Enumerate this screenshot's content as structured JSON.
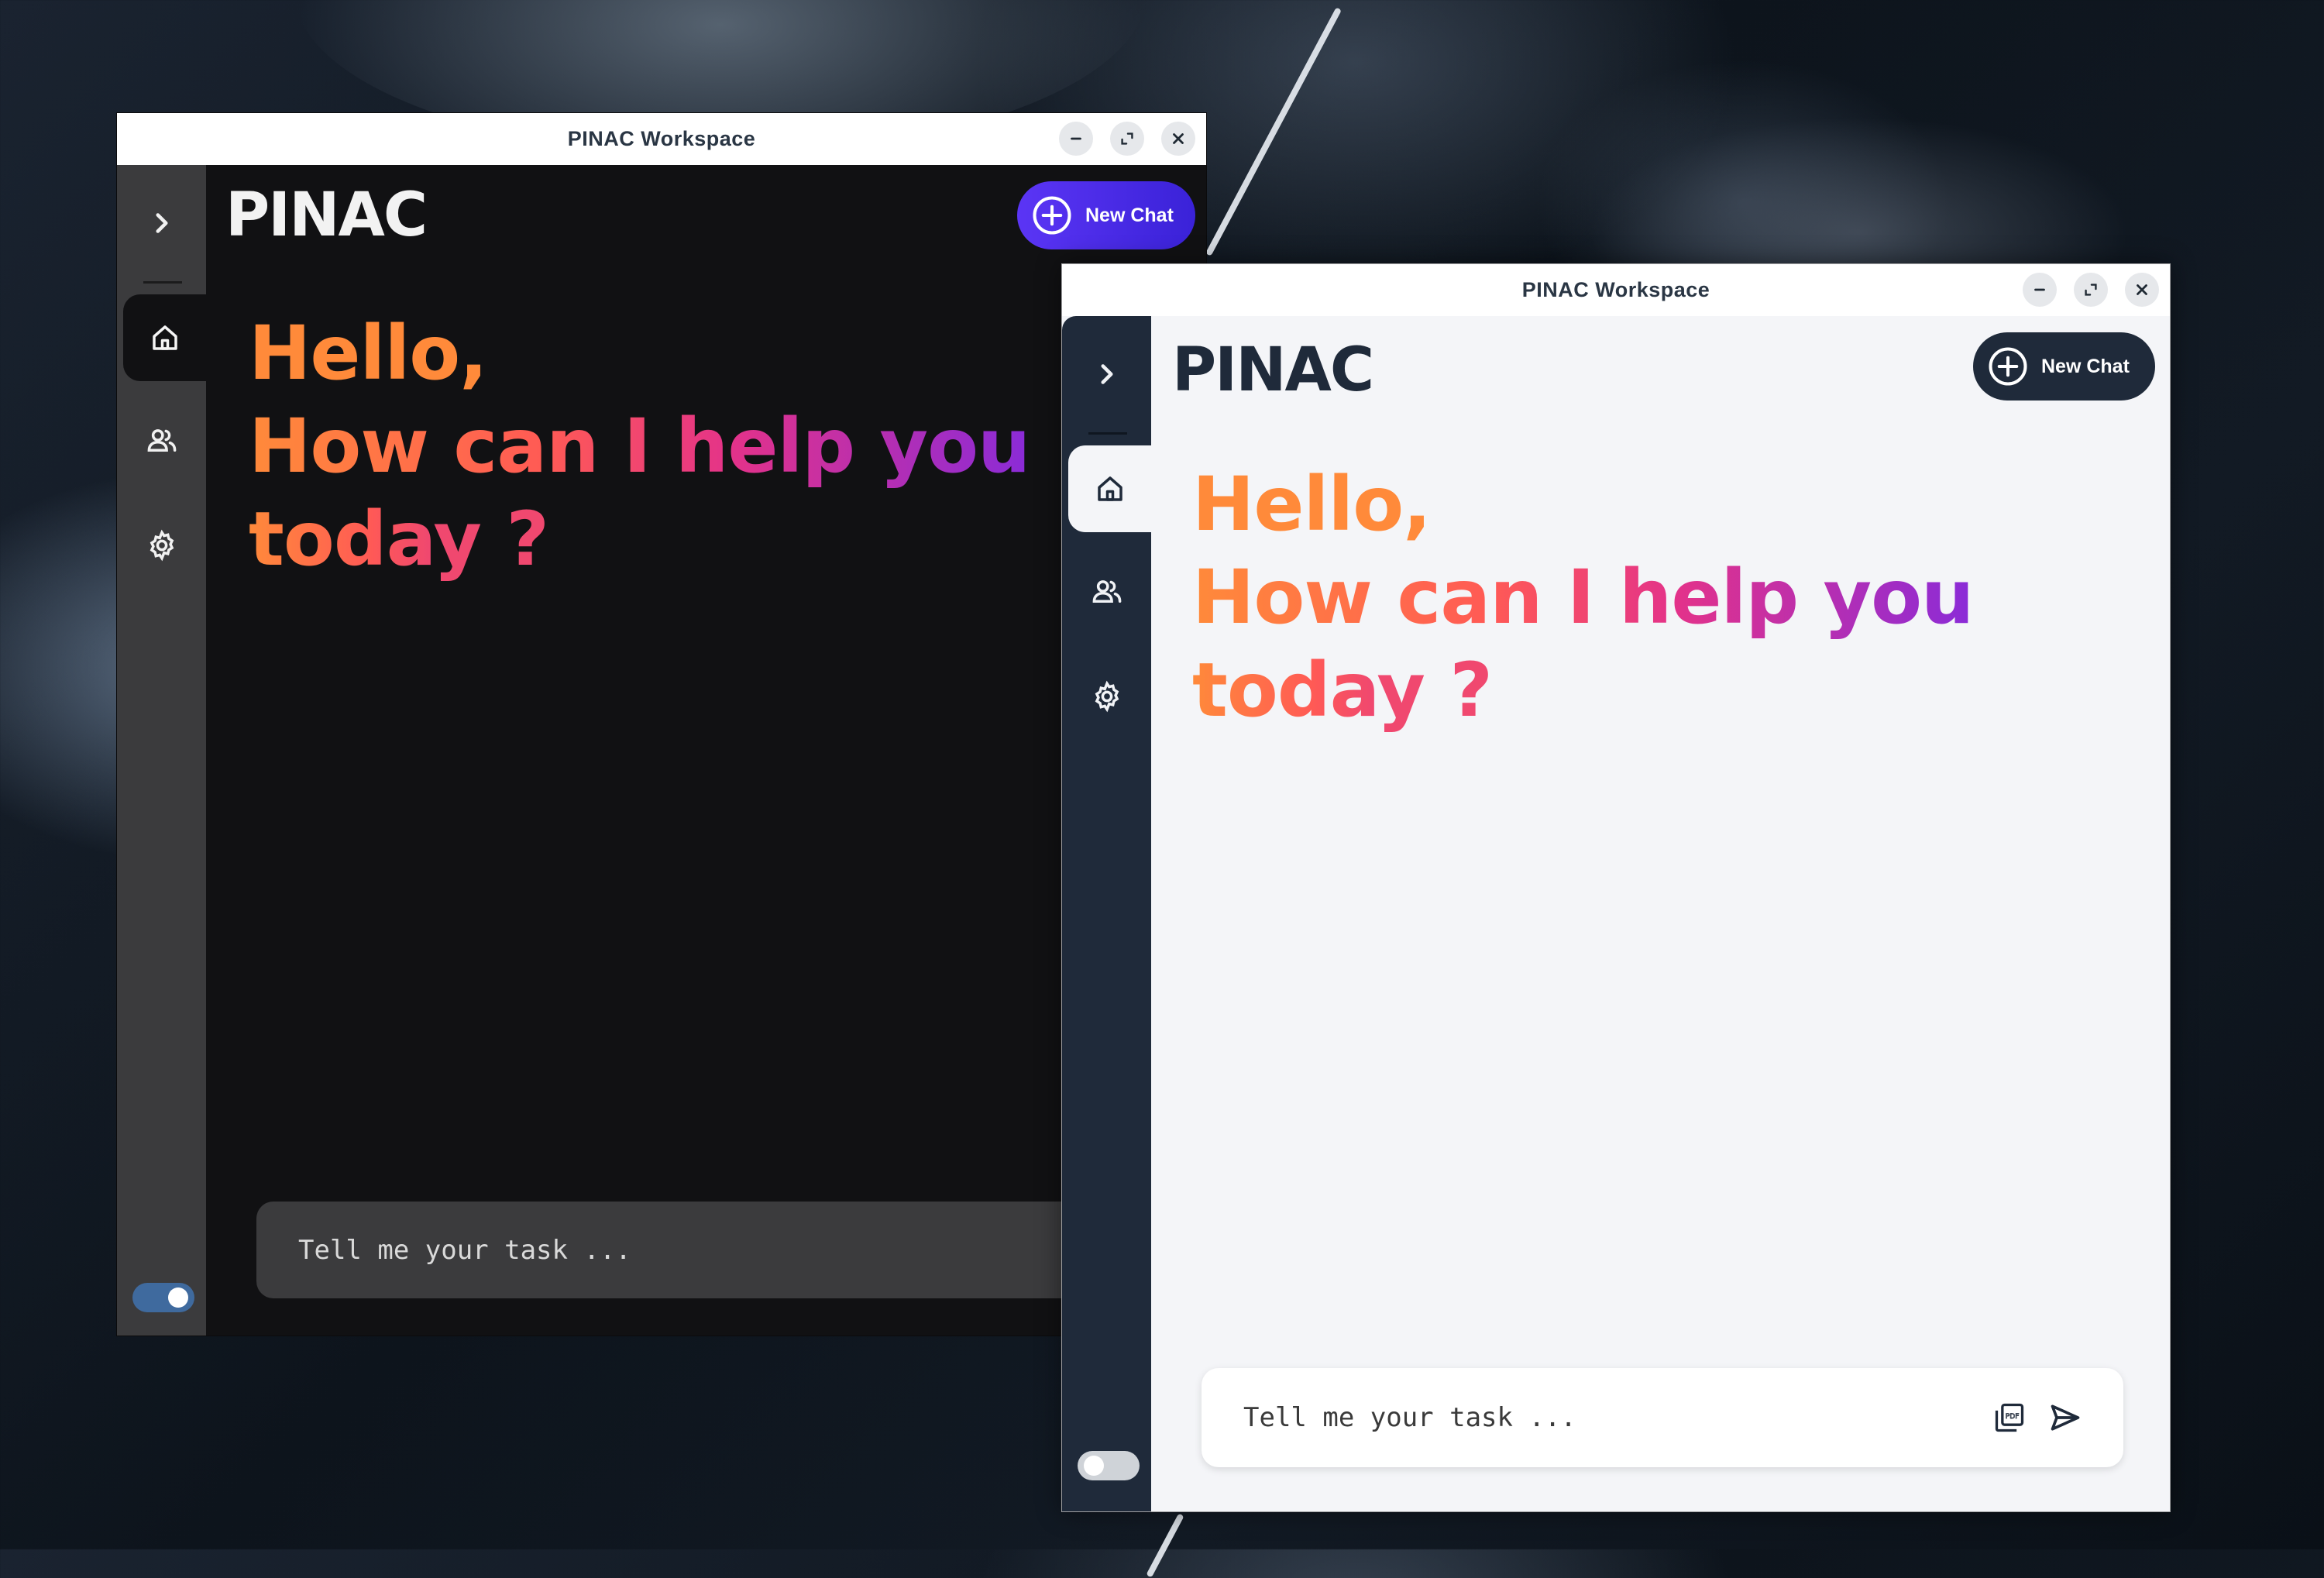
{
  "desktop": {
    "wallpaper": "astronaut-space-wallpaper"
  },
  "windows": [
    {
      "theme": "dark",
      "title": "PINAC Workspace",
      "logo_text": "PINAC",
      "new_chat_label": "New Chat",
      "greeting": {
        "line1": "Hello,",
        "line2": "How can I help you",
        "line3": "today ?"
      },
      "input_placeholder": "Tell me your task ...",
      "accent": "#4a2ee6",
      "toggle_on": true
    },
    {
      "theme": "light",
      "title": "PINAC Workspace",
      "logo_text": "PINAC",
      "new_chat_label": "New Chat",
      "greeting": {
        "line1": "Hello,",
        "line2": "How can I help you",
        "line3": "today ?"
      },
      "input_placeholder": "Tell me your task ...",
      "accent": "#1f2a3a",
      "toggle_on": false
    }
  ],
  "icons": {
    "sidebar": [
      "chevron-right-icon",
      "home-icon",
      "users-icon",
      "gear-icon"
    ],
    "input": [
      "pdf-attach-icon",
      "send-icon"
    ],
    "window_controls": [
      "minimize-icon",
      "maximize-icon",
      "close-icon"
    ]
  },
  "colors": {
    "gradient_start": "#ff8a3a",
    "gradient_mid": "#e3328a",
    "gradient_end": "#8a2bd8"
  }
}
